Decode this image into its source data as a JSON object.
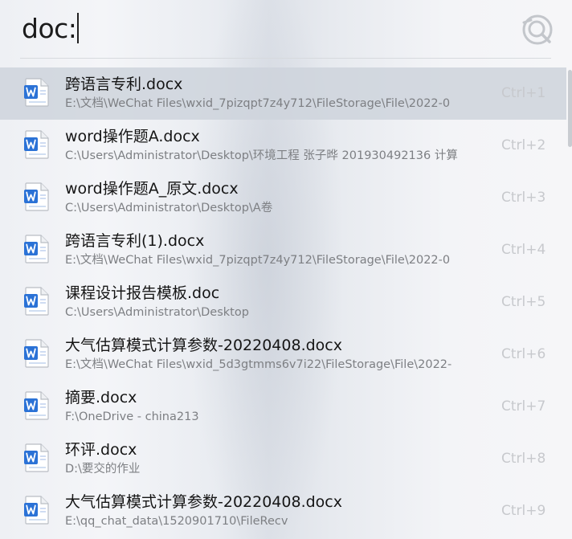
{
  "search": {
    "query": "doc:"
  },
  "app": {
    "logo_icon": "search-app-logo-icon"
  },
  "results": [
    {
      "title": "跨语言专利.docx",
      "path": "E:\\文档\\WeChat Files\\wxid_7pizqpt7z4y712\\FileStorage\\File\\2022-0",
      "shortcut": "Ctrl+1",
      "icon": "word-document-icon",
      "selected": true
    },
    {
      "title": "word操作题A.docx",
      "path": "C:\\Users\\Administrator\\Desktop\\环境工程 张子晔 201930492136 计算",
      "shortcut": "Ctrl+2",
      "icon": "word-document-icon",
      "selected": false
    },
    {
      "title": "word操作题A_原文.docx",
      "path": "C:\\Users\\Administrator\\Desktop\\A卷",
      "shortcut": "Ctrl+3",
      "icon": "word-document-icon",
      "selected": false
    },
    {
      "title": "跨语言专利(1).docx",
      "path": "E:\\文档\\WeChat Files\\wxid_7pizqpt7z4y712\\FileStorage\\File\\2022-0",
      "shortcut": "Ctrl+4",
      "icon": "word-document-icon",
      "selected": false
    },
    {
      "title": "课程设计报告模板.doc",
      "path": "C:\\Users\\Administrator\\Desktop",
      "shortcut": "Ctrl+5",
      "icon": "word-document-icon",
      "selected": false
    },
    {
      "title": "大气估算模式计算参数-20220408.docx",
      "path": "E:\\文档\\WeChat Files\\wxid_5d3gtmms6v7i22\\FileStorage\\File\\2022-",
      "shortcut": "Ctrl+6",
      "icon": "word-document-icon",
      "selected": false
    },
    {
      "title": "摘要.docx",
      "path": "F:\\OneDrive - china213",
      "shortcut": "Ctrl+7",
      "icon": "word-document-icon",
      "selected": false
    },
    {
      "title": "环评.docx",
      "path": "D:\\要交的作业",
      "shortcut": "Ctrl+8",
      "icon": "word-document-icon",
      "selected": false
    },
    {
      "title": "大气估算模式计算参数-20220408.docx",
      "path": "E:\\qq_chat_data\\1520901710\\FileRecv",
      "shortcut": "Ctrl+9",
      "icon": "word-document-icon",
      "selected": false
    }
  ],
  "colors": {
    "word_blue": "#2b72d6",
    "selected_row": "#cfd4dc",
    "shortcut_text": "#c7c9cd"
  }
}
